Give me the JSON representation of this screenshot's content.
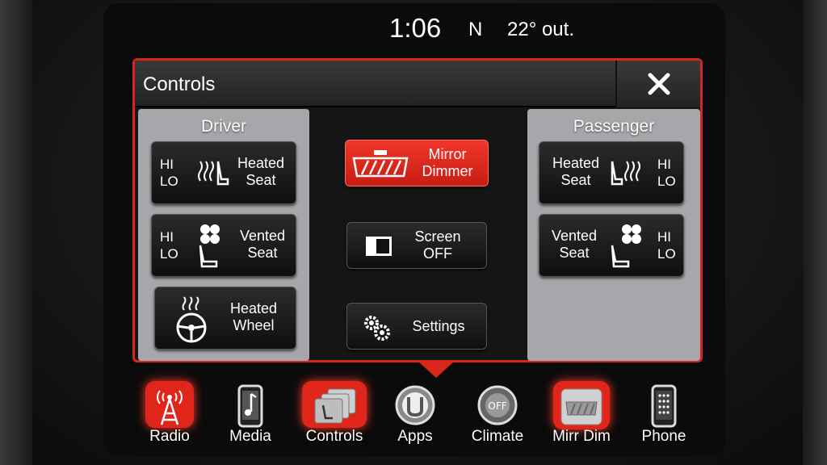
{
  "status": {
    "time": "1:06",
    "heading": "N",
    "outside_temp": "22° out."
  },
  "panel": {
    "title": "Controls"
  },
  "driver": {
    "title": "Driver",
    "heated_seat": {
      "hi": "HI",
      "lo": "LO",
      "line1": "Heated",
      "line2": "Seat"
    },
    "vented_seat": {
      "hi": "HI",
      "lo": "LO",
      "line1": "Vented",
      "line2": "Seat"
    },
    "heated_wheel": {
      "line1": "Heated",
      "line2": "Wheel"
    }
  },
  "center": {
    "mirror_dimmer": {
      "line1": "Mirror",
      "line2": "Dimmer"
    },
    "screen_off": {
      "line1": "Screen",
      "line2": "OFF"
    },
    "settings": {
      "label": "Settings"
    }
  },
  "passenger": {
    "title": "Passenger",
    "heated_seat": {
      "hi": "HI",
      "lo": "LO",
      "line1": "Heated",
      "line2": "Seat"
    },
    "vented_seat": {
      "hi": "HI",
      "lo": "LO",
      "line1": "Vented",
      "line2": "Seat"
    }
  },
  "dock": [
    {
      "label": "Radio",
      "icon": "radio-tower-icon"
    },
    {
      "label": "Media",
      "icon": "media-player-icon"
    },
    {
      "label": "Controls",
      "icon": "controls-icon"
    },
    {
      "label": "Apps",
      "icon": "apps-icon"
    },
    {
      "label": "Climate",
      "icon": "climate-icon"
    },
    {
      "label": "Mirr Dim",
      "icon": "mirror-dim-icon"
    },
    {
      "label": "Phone",
      "icon": "phone-icon"
    }
  ],
  "colors": {
    "accent": "#d9261c",
    "zone_bg": "#a7a7ab"
  }
}
